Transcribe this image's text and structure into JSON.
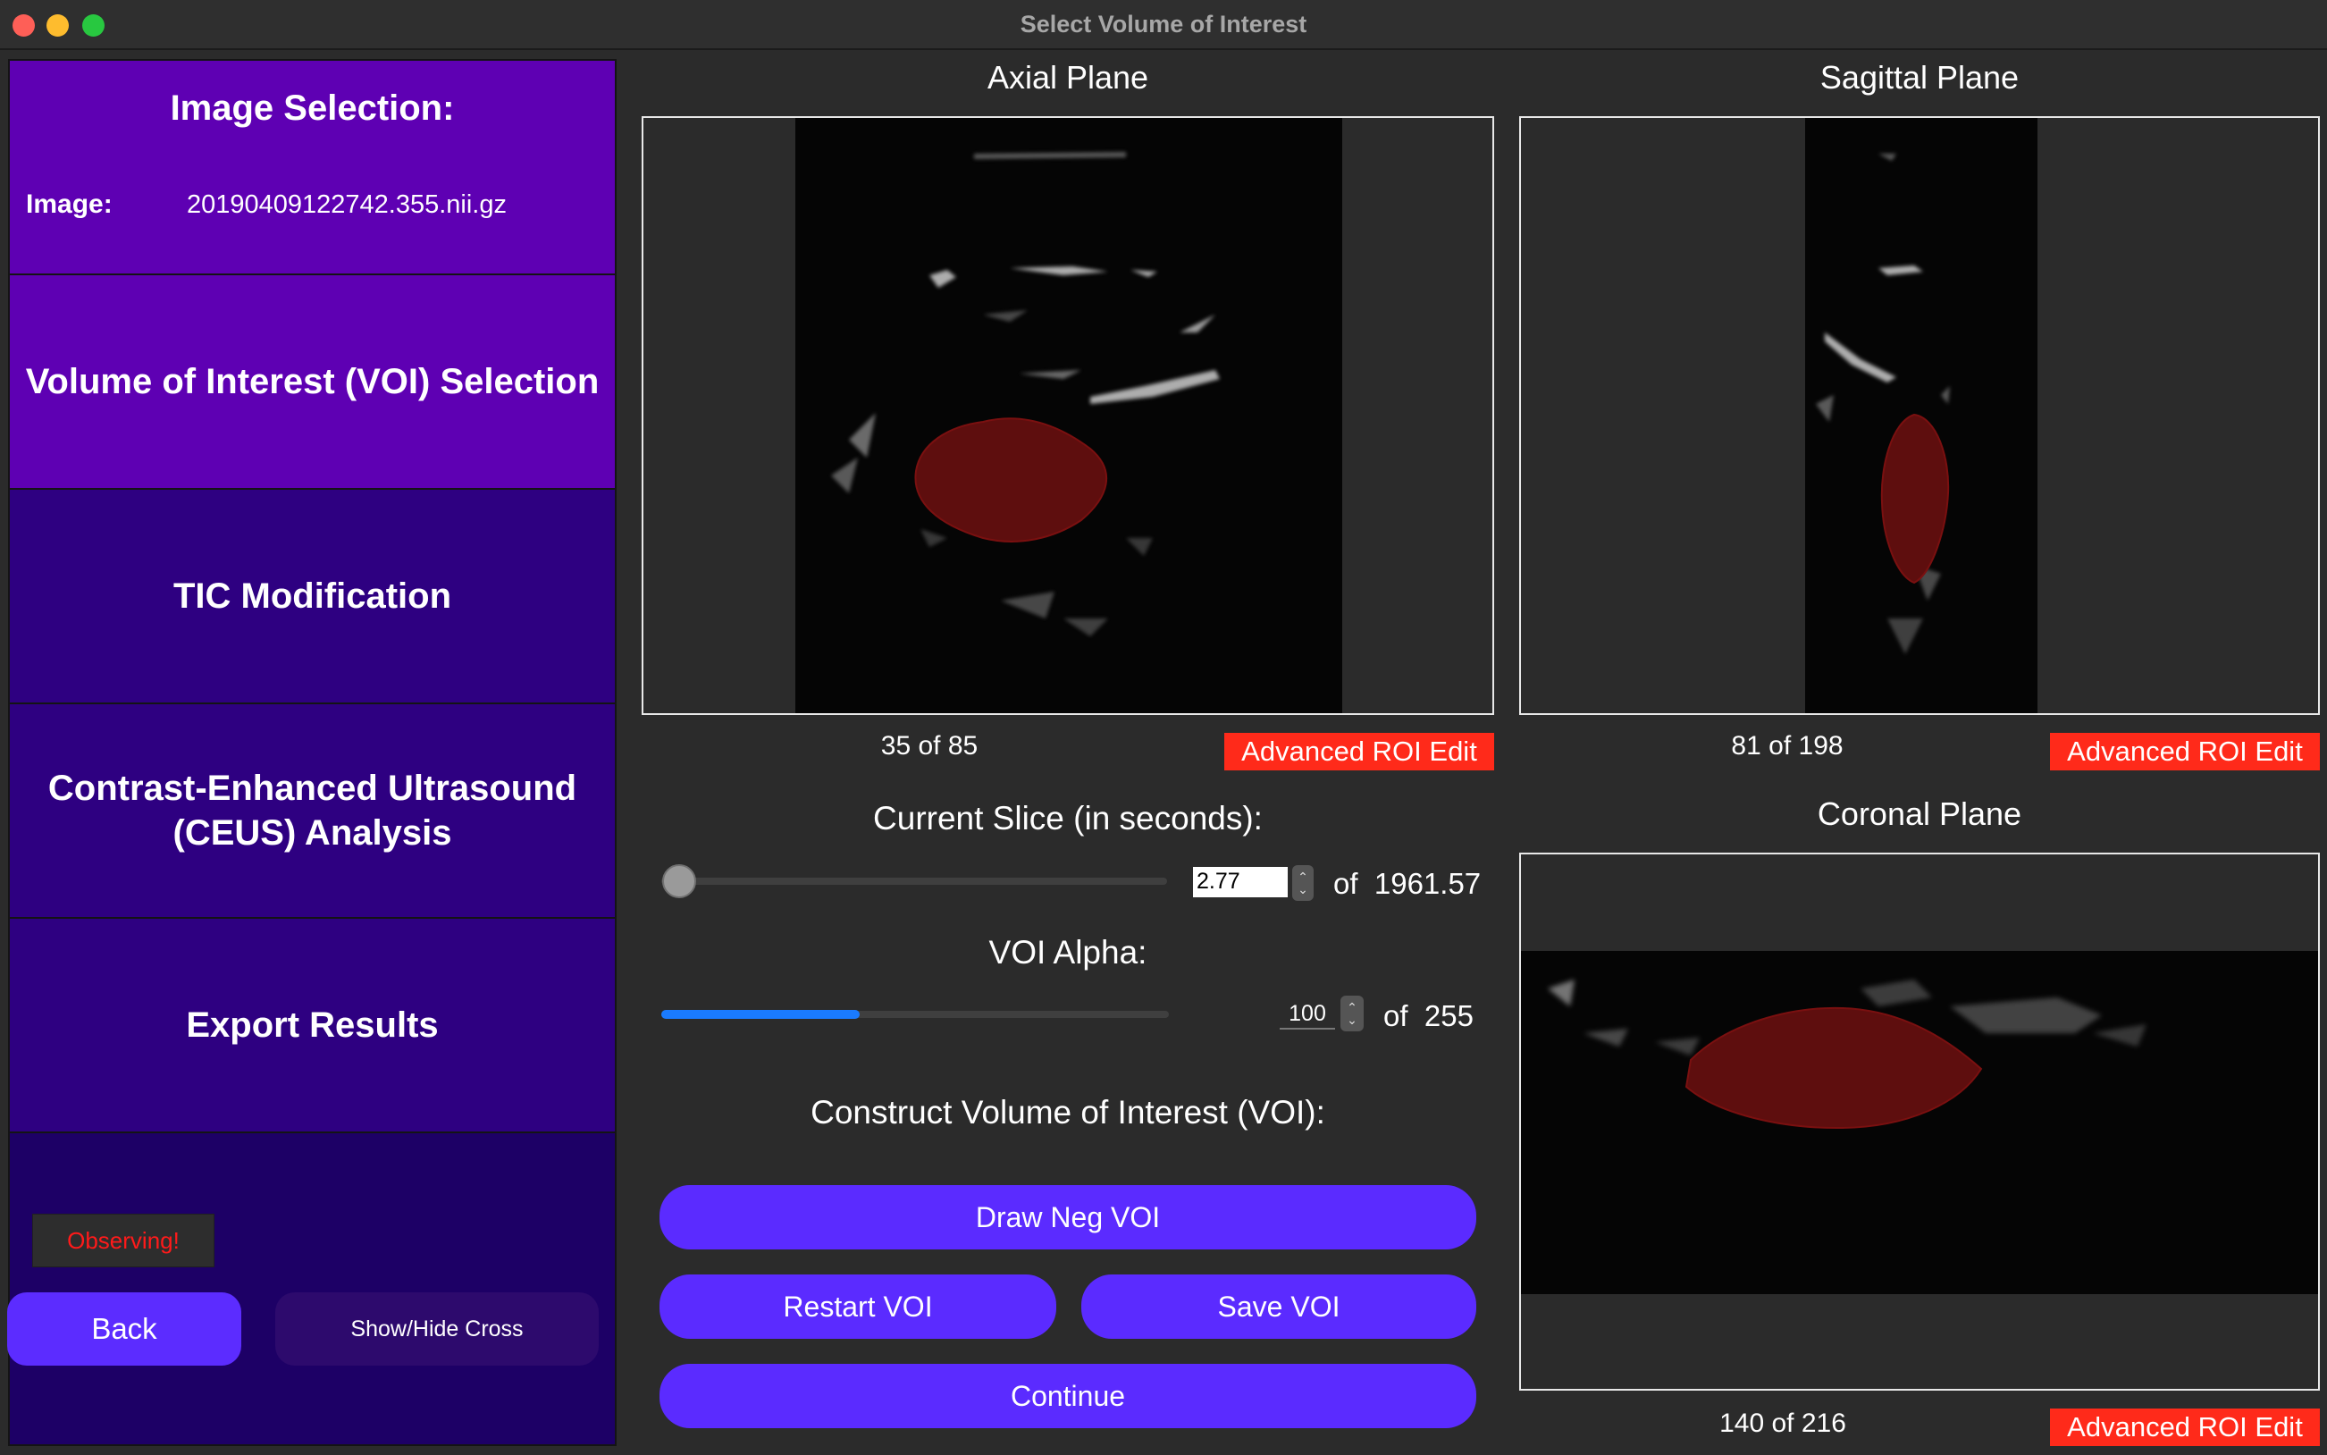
{
  "window": {
    "title": "Select Volume of Interest"
  },
  "sidebar": {
    "image_section": {
      "heading": "Image Selection:",
      "label": "Image:",
      "value": "20190409122742.355.nii.gz"
    },
    "sections": {
      "voi": "Volume of Interest (VOI) Selection",
      "tic": "TIC Modification",
      "ceus": "Contrast-Enhanced Ultrasound (CEUS) Analysis",
      "export": "Export Results"
    },
    "status": "Observing!",
    "back_label": "Back",
    "cross_label": "Show/Hide Cross"
  },
  "axial": {
    "title": "Axial Plane",
    "slice": "35",
    "total": "85",
    "roi_label": "Advanced ROI Edit"
  },
  "sagittal": {
    "title": "Sagittal Plane",
    "slice": "81",
    "total": "198",
    "roi_label": "Advanced ROI Edit"
  },
  "coronal": {
    "title": "Coronal Plane",
    "slice": "140",
    "total": "216",
    "roi_label": "Advanced ROI Edit"
  },
  "of_word": "of",
  "current_slice": {
    "label": "Current Slice (in seconds):",
    "value": "2.77",
    "max": "1961.57",
    "fraction": 0.0014
  },
  "voi_alpha": {
    "label": "VOI Alpha:",
    "value": "100",
    "max": "255",
    "fraction": 0.39
  },
  "construct": {
    "label": "Construct Volume of Interest (VOI):",
    "draw_neg": "Draw Neg VOI",
    "restart": "Restart VOI",
    "save": "Save VOI",
    "continue": "Continue"
  },
  "colors": {
    "sidebar_active": "#5e00b3",
    "sidebar_inactive": "#2e0081",
    "button": "#5b2bff",
    "roi_button": "#ff2a1a",
    "overlay": "#7a0f0f"
  }
}
